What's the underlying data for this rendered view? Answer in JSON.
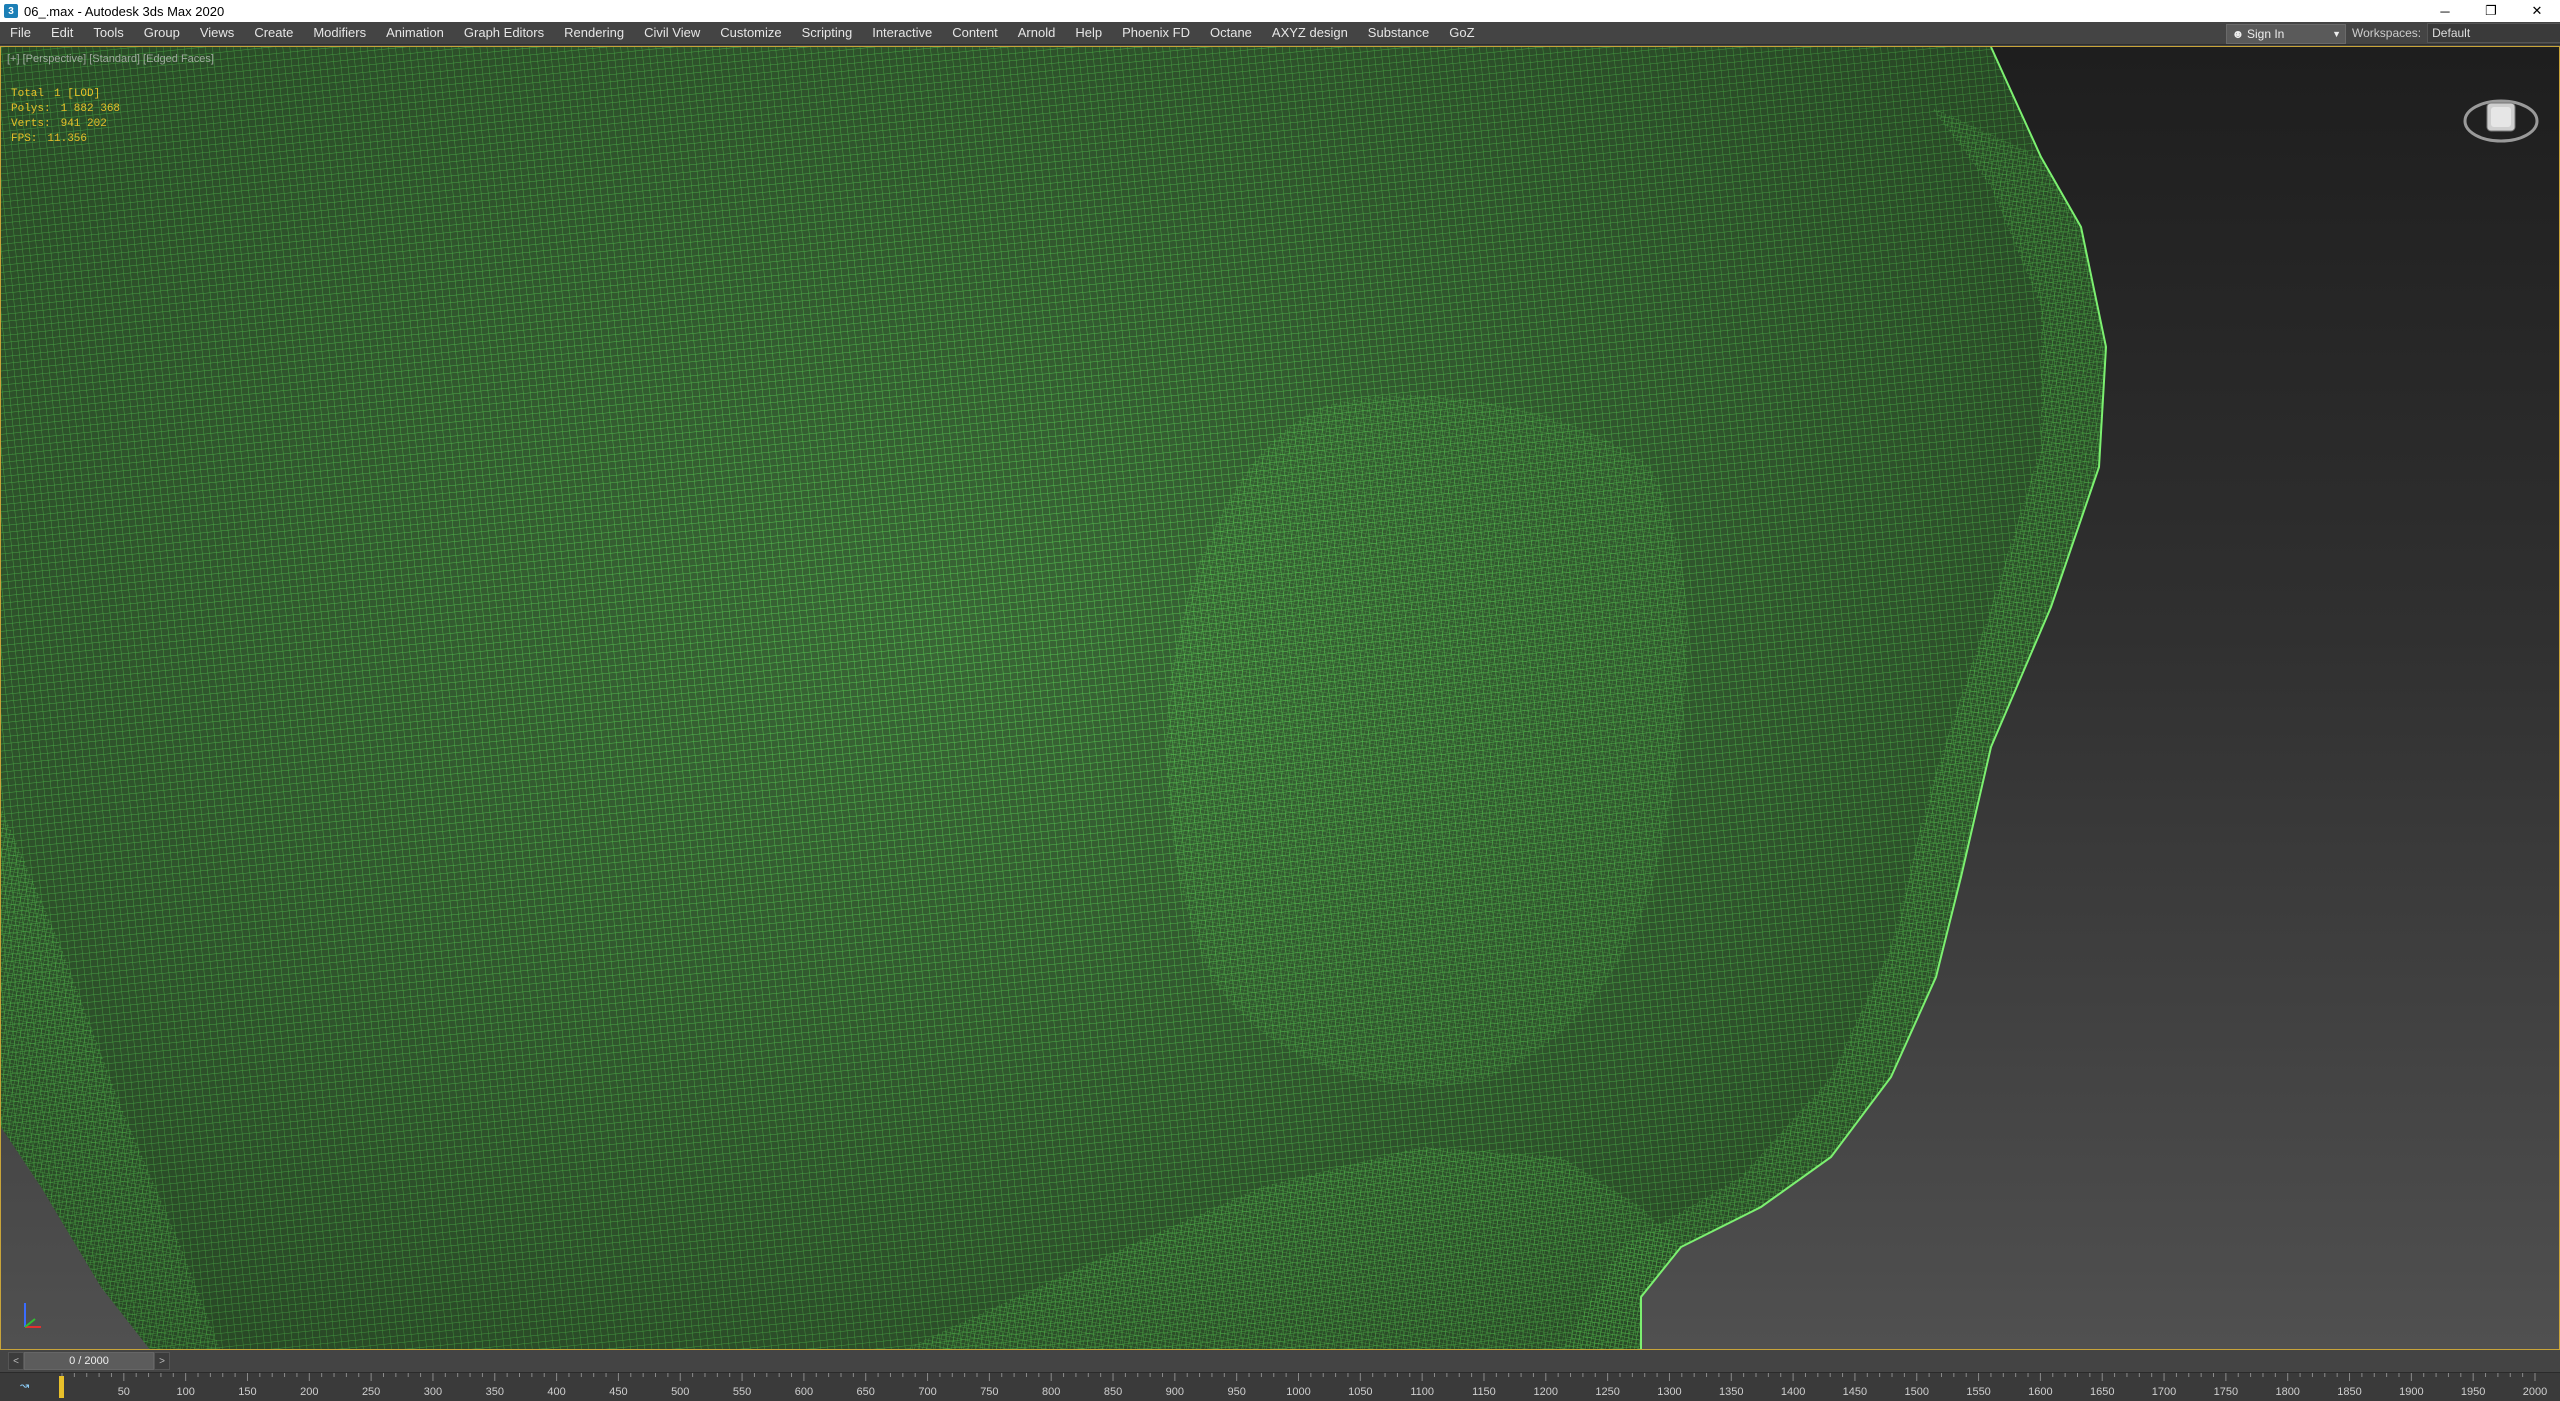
{
  "window": {
    "title": "06_.max - Autodesk 3ds Max 2020",
    "app_icon": "3",
    "controls": {
      "minimize": "─",
      "restore": "❐",
      "close": "✕"
    }
  },
  "menu": [
    "File",
    "Edit",
    "Tools",
    "Group",
    "Views",
    "Create",
    "Modifiers",
    "Animation",
    "Graph Editors",
    "Rendering",
    "Civil View",
    "Customize",
    "Scripting",
    "Interactive",
    "Content",
    "Arnold",
    "Help",
    "Phoenix FD",
    "Octane",
    "AXYZ design",
    "Substance",
    "GoZ"
  ],
  "signin": {
    "label": "Sign In",
    "icon": "user-icon"
  },
  "workspaces": {
    "label": "Workspaces:",
    "value": "Default"
  },
  "viewport": {
    "label": "[+] [Perspective] [Standard] [Edged Faces]",
    "mesh_color": "#4fd24a",
    "stats": [
      {
        "name": "Total",
        "value": "1 [LOD]"
      },
      {
        "name": "Polys:",
        "value": "1 882 368"
      },
      {
        "name": "Verts:",
        "value": "941 202"
      },
      {
        "name": "FPS:",
        "value": "11.356"
      }
    ]
  },
  "timeslider": {
    "value": "0 / 2000",
    "prev": "<",
    "next": ">"
  },
  "trackbar": {
    "ticks": [
      "50",
      "100",
      "150",
      "200",
      "250",
      "300",
      "350",
      "400",
      "450",
      "500",
      "550",
      "600",
      "650",
      "700",
      "750",
      "800",
      "850",
      "900",
      "950",
      "1000",
      "1050",
      "1100",
      "1150",
      "1200",
      "1250",
      "1300",
      "1350",
      "1400",
      "1450",
      "1500",
      "1550",
      "1600",
      "1650",
      "1700",
      "1750",
      "1800",
      "1850",
      "1900",
      "1950",
      "2000"
    ]
  },
  "colors": {
    "accent": "#e8c02a",
    "mesh": "#4fd24a",
    "background": "#444444"
  }
}
